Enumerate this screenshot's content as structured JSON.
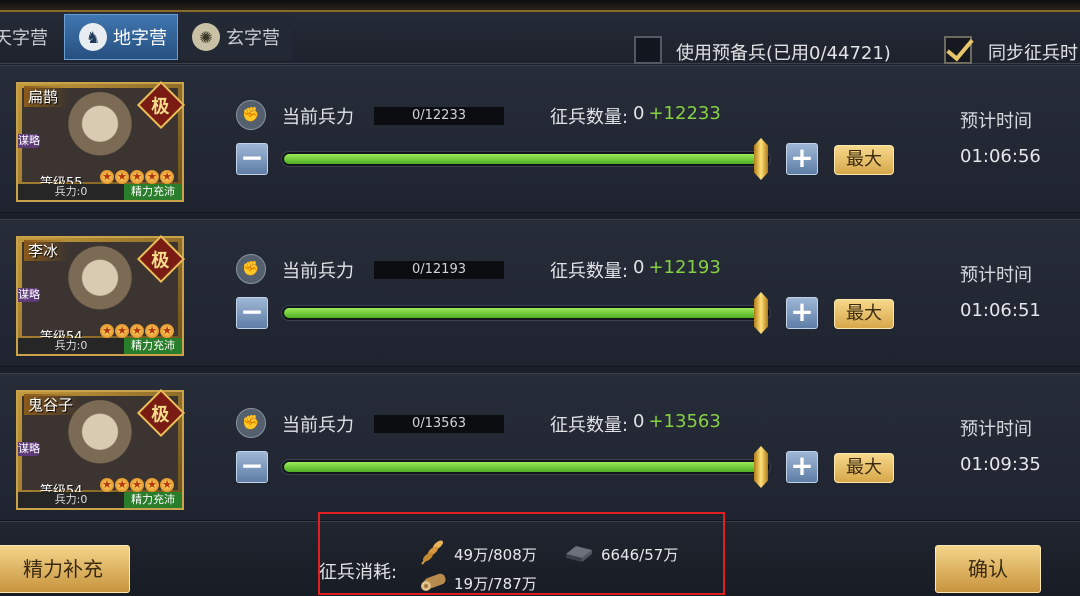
{
  "tabs": [
    {
      "label": "天字营",
      "icon": "tian-camp-icon"
    },
    {
      "label": "地字营",
      "icon": "horse-head-icon",
      "active": true
    },
    {
      "label": "玄字营",
      "icon": "xuan-camp-icon"
    }
  ],
  "options": {
    "reserve_label": "使用预备兵(已用0/44721)",
    "reserve_checked": false,
    "sync_label": "同步征兵时",
    "sync_checked": true
  },
  "labels": {
    "current_troops": "当前兵力",
    "recruit_count": "征兵数量:",
    "eta": "预计时间",
    "max": "最大",
    "minus": "−",
    "plus": "+"
  },
  "generals": [
    {
      "name": "扁鹊",
      "rank": "极",
      "tag": "谋略",
      "level": "等级55",
      "stars": 5,
      "troops_label": "兵力:0",
      "energy_label": "精力充沛",
      "current": "0/12233",
      "recruit_base": "0",
      "recruit_add": "+12233",
      "eta": "01:06:56",
      "slider_fraction": 1.0
    },
    {
      "name": "李冰",
      "rank": "极",
      "tag": "谋略",
      "level": "等级54",
      "stars": 5,
      "troops_label": "兵力:0",
      "energy_label": "精力充沛",
      "current": "0/12193",
      "recruit_base": "0",
      "recruit_add": "+12193",
      "eta": "01:06:51",
      "slider_fraction": 1.0
    },
    {
      "name": "鬼谷子",
      "rank": "极",
      "tag": "谋略",
      "level": "等级54",
      "stars": 5,
      "troops_label": "兵力:0",
      "energy_label": "精力充沛",
      "current": "0/13563",
      "recruit_base": "0",
      "recruit_add": "+13563",
      "eta": "01:09:35",
      "slider_fraction": 1.0
    }
  ],
  "footer": {
    "replenish_label": "精力补充",
    "cost_label": "征兵消耗:",
    "grain": "49万/808万",
    "iron": "6646/57万",
    "wood": "19万/787万",
    "confirm_label": "确认"
  },
  "colors": {
    "accent_gold": "#e7c56b",
    "green_bar": "#6fcf33",
    "plus_green": "#86d043",
    "highlight_red": "#e02020"
  }
}
